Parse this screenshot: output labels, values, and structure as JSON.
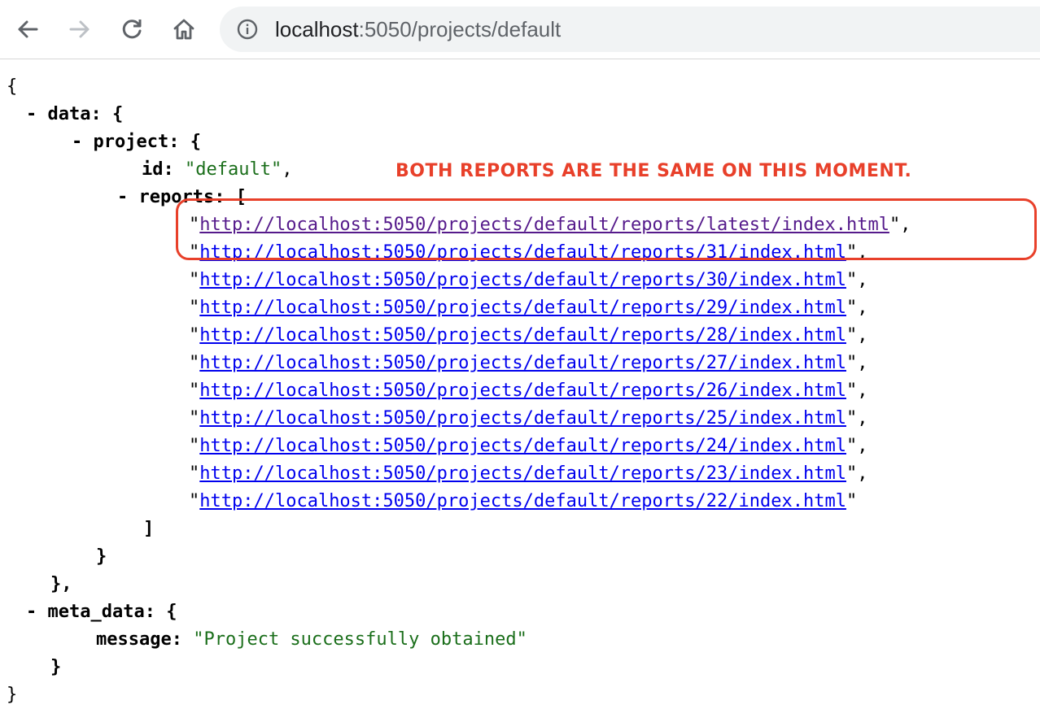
{
  "browser": {
    "url_host": "localhost",
    "url_path": ":5050/projects/default",
    "icons": {
      "back": "arrow-left-icon",
      "forward": "arrow-right-icon",
      "reload": "reload-icon",
      "home": "home-icon",
      "info": "info-icon"
    }
  },
  "json_view": {
    "open_brace": "{",
    "close_brace": "}",
    "collapse_marker": "-",
    "data_key": "data",
    "project_key": "project",
    "id_key": "id",
    "id_value": "default",
    "reports_key": "reports",
    "reports": [
      "http://localhost:5050/projects/default/reports/latest/index.html",
      "http://localhost:5050/projects/default/reports/31/index.html",
      "http://localhost:5050/projects/default/reports/30/index.html",
      "http://localhost:5050/projects/default/reports/29/index.html",
      "http://localhost:5050/projects/default/reports/28/index.html",
      "http://localhost:5050/projects/default/reports/27/index.html",
      "http://localhost:5050/projects/default/reports/26/index.html",
      "http://localhost:5050/projects/default/reports/25/index.html",
      "http://localhost:5050/projects/default/reports/24/index.html",
      "http://localhost:5050/projects/default/reports/23/index.html",
      "http://localhost:5050/projects/default/reports/22/index.html"
    ],
    "meta_data_key": "meta_data",
    "message_key": "message",
    "message_value": "Project successfully obtained"
  },
  "annotation": {
    "text": "BOTH REPORTS ARE THE SAME ON THIS MOMENT.",
    "color": "#e8402a"
  },
  "colors": {
    "link": "#0000ee",
    "visited_link": "#551a8b",
    "string": "#1a6e1a"
  }
}
